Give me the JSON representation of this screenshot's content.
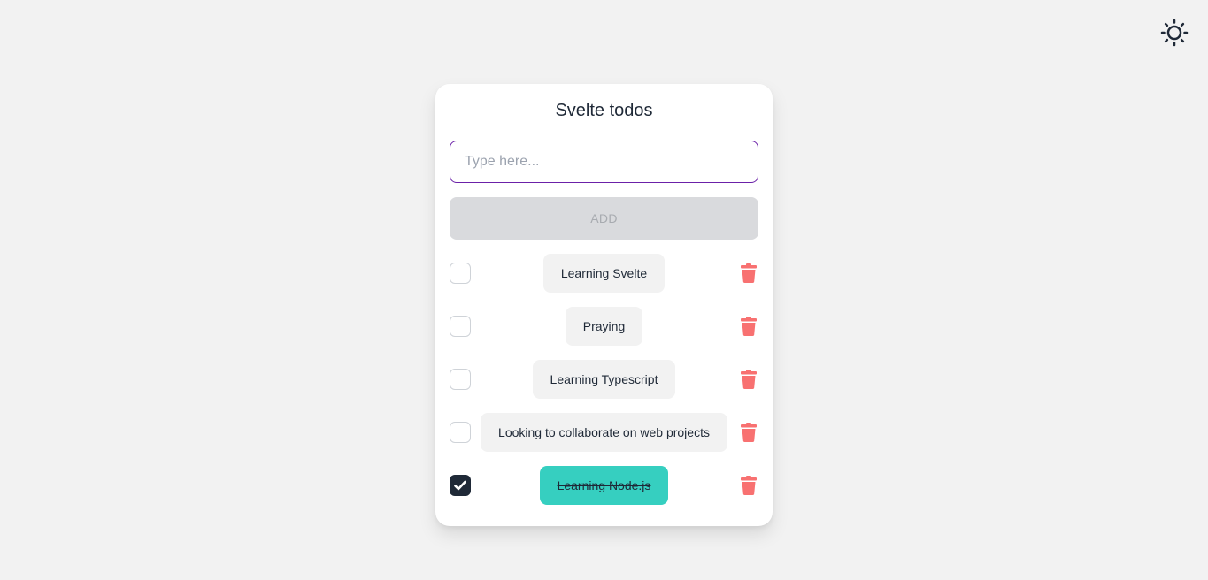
{
  "header": {
    "theme_toggle_icon": "sun-icon"
  },
  "app": {
    "title": "Svelte todos",
    "input": {
      "placeholder": "Type here...",
      "value": ""
    },
    "add_button_label": "ADD",
    "todos": [
      {
        "text": "Learning Svelte",
        "done": false
      },
      {
        "text": "Praying",
        "done": false
      },
      {
        "text": "Learning Typescript",
        "done": false
      },
      {
        "text": "Looking to collaborate on web projects",
        "done": false
      },
      {
        "text": "Learning Node.js",
        "done": true
      }
    ]
  },
  "colors": {
    "background": "#f2f2f2",
    "card": "#ffffff",
    "input_border": "#6b21a8",
    "done_accent": "#36cfc0",
    "delete": "#f87171",
    "checked": "#1f2937"
  }
}
